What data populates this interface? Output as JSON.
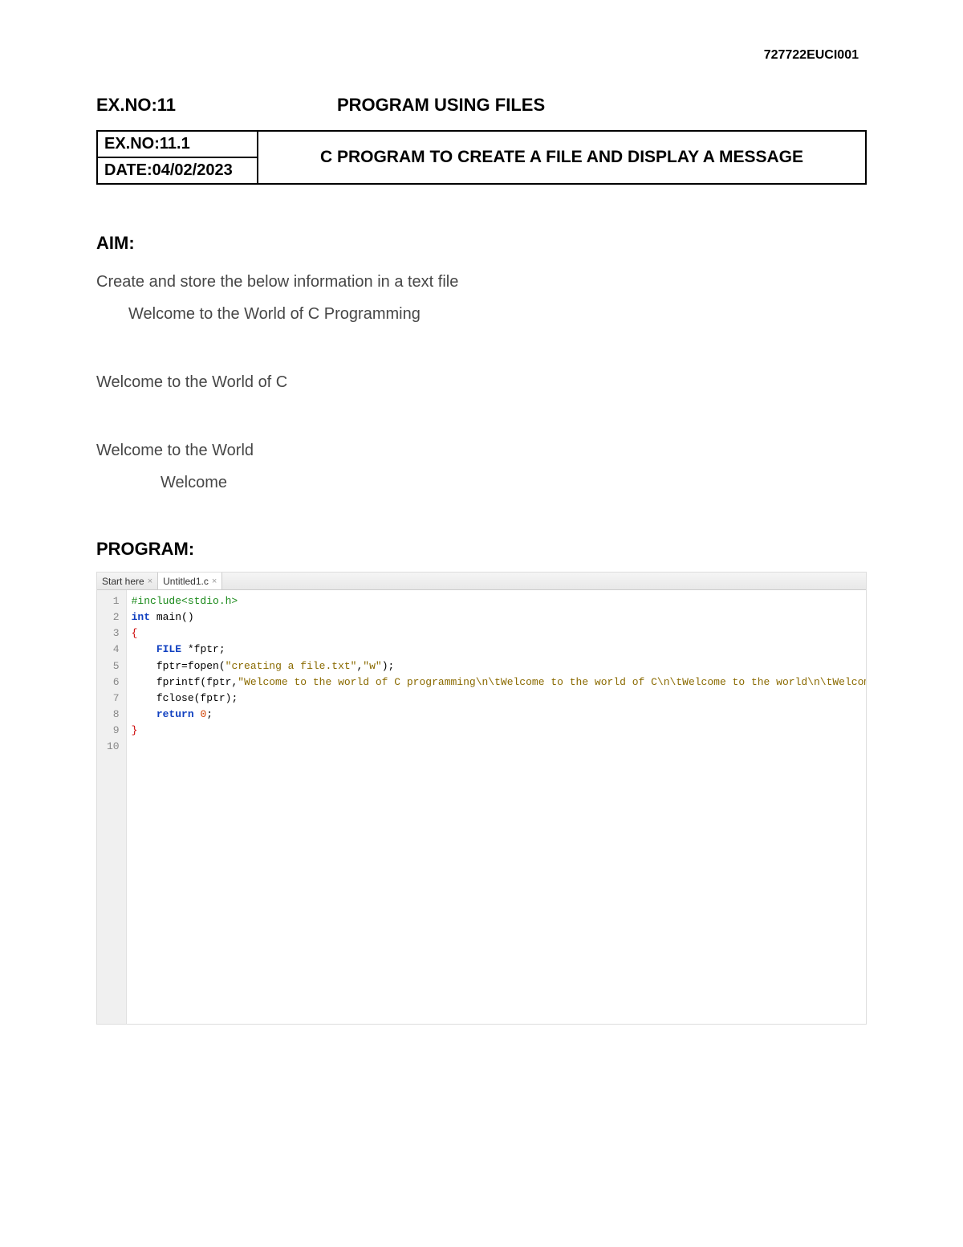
{
  "header_id": "727722EUCI001",
  "ex_no_main": "EX.NO:11",
  "page_title": "PROGRAM USING FILES",
  "table": {
    "ex_no_sub": "EX.NO:11.1",
    "date": "DATE:04/02/2023",
    "subtitle": "C PROGRAM TO CREATE A FILE AND DISPLAY A MESSAGE"
  },
  "aim_heading": "AIM:",
  "aim_lines": {
    "l1": "Create and store the below information in a text file",
    "l2": "Welcome to the World of C Programming",
    "l3": "Welcome to the World of C",
    "l4": "Welcome to the World",
    "l5": "Welcome"
  },
  "program_heading": "PROGRAM:",
  "editor": {
    "tabs": {
      "t1": "Start here",
      "t2": "Untitled1.c"
    },
    "line_count": 10,
    "code": {
      "l1_pre": "#include<stdio.h>",
      "l2_kw_int": "int",
      "l2_fn": " main",
      "l2_rest": "()",
      "l3_brace": "{",
      "l4_indent": "    ",
      "l4_type": "FILE",
      "l4_rest": " *fptr;",
      "l5_indent": "    ",
      "l5_a": "fptr=fopen(",
      "l5_s1": "\"creating a file.txt\"",
      "l5_c": ",",
      "l5_s2": "\"w\"",
      "l5_end": ");",
      "l6_indent": "    ",
      "l6_a": "fprintf(fptr,",
      "l6_s": "\"Welcome to the world of C programming\\n\\tWelcome to the world of C\\n\\tWelcome to the world\\n\\tWelcome\"",
      "l6_end": ");",
      "l7_indent": "    ",
      "l7": "fclose(fptr);",
      "l8_indent": "    ",
      "l8_kw": "return",
      "l8_sp": " ",
      "l8_num": "0",
      "l8_end": ";",
      "l9_brace": "}",
      "l10": ""
    }
  }
}
